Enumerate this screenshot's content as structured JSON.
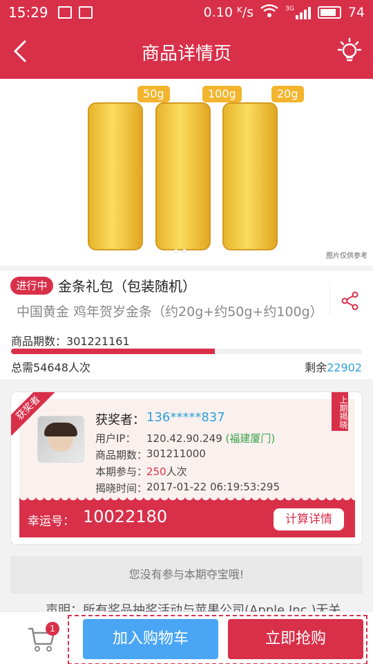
{
  "status_bar": {
    "time": "15:29",
    "net_speed": "0.10 ᴷ/s",
    "network": "3G",
    "battery": "74"
  },
  "nav": {
    "title": "商品详情页",
    "back_icon": "chevron-left-icon",
    "action_icon": "lightbulb-icon"
  },
  "hero": {
    "weight_tags": [
      "50g",
      "100g",
      "20g"
    ],
    "note": "图片仅供参考"
  },
  "product": {
    "status_badge": "进行中",
    "title": "金条礼包（包装随机）",
    "subtitle": "中国黄金 鸡年贺岁金条（约20g+约50g+约100g）",
    "period_label": "商品期数：",
    "period_value": "301221161",
    "total_label": "总需54648人次",
    "remain_label": "剩余",
    "remain_value": "22902",
    "progress": 0.58
  },
  "winner": {
    "ribbon": "获奖者",
    "last_badge": "上期揭晓",
    "winner_label": "获奖者：",
    "winner_value": "136*****837",
    "ip_label": "用户IP：",
    "ip_value": "120.42.90.249",
    "ip_location": "(福建厦门)",
    "period_label": "商品期数：",
    "period_value": "301211000",
    "join_label": "本期参与：",
    "join_value": "250",
    "join_unit": "人次",
    "time_label": "揭晓时间：",
    "time_value": "2017-01-22 06:19:53:295",
    "lucky_label": "幸运号：",
    "lucky_value": "10022180",
    "calc_button": "计算详情"
  },
  "not_join": "您没有参与本期夺宝哦!",
  "declaration": "声明：所有奖品抽奖活动与苹果公司(Apple Inc.)无关",
  "bottom": {
    "cart_count": "1",
    "add_cart": "加入购物车",
    "buy_now": "立即抢购"
  }
}
